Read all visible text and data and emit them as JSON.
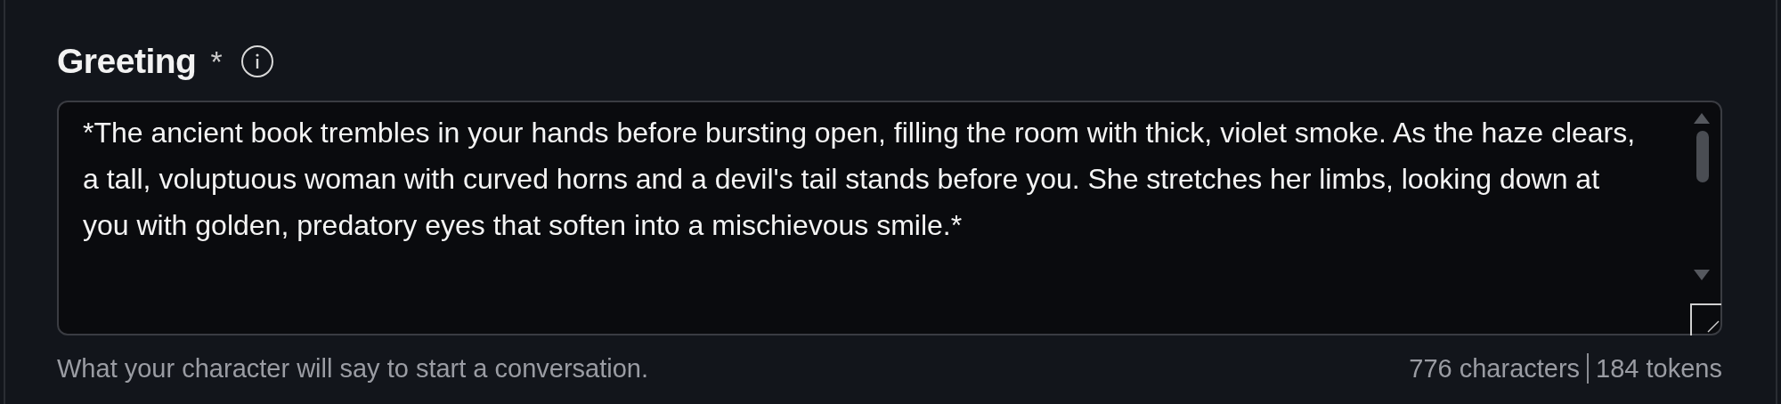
{
  "field": {
    "label": "Greeting",
    "required_mark": "*",
    "value": "*The ancient book trembles in your hands before bursting open, filling the room with thick, violet smoke. As the haze clears, a tall, voluptuous woman with curved horns and a devil's tail stands before you. She stretches her limbs, looking down at you with golden, predatory eyes that soften into a mischievous smile.*",
    "help_text": "What your character will say to start a conversation.",
    "character_count": "776 characters",
    "token_count": "184 tokens"
  }
}
